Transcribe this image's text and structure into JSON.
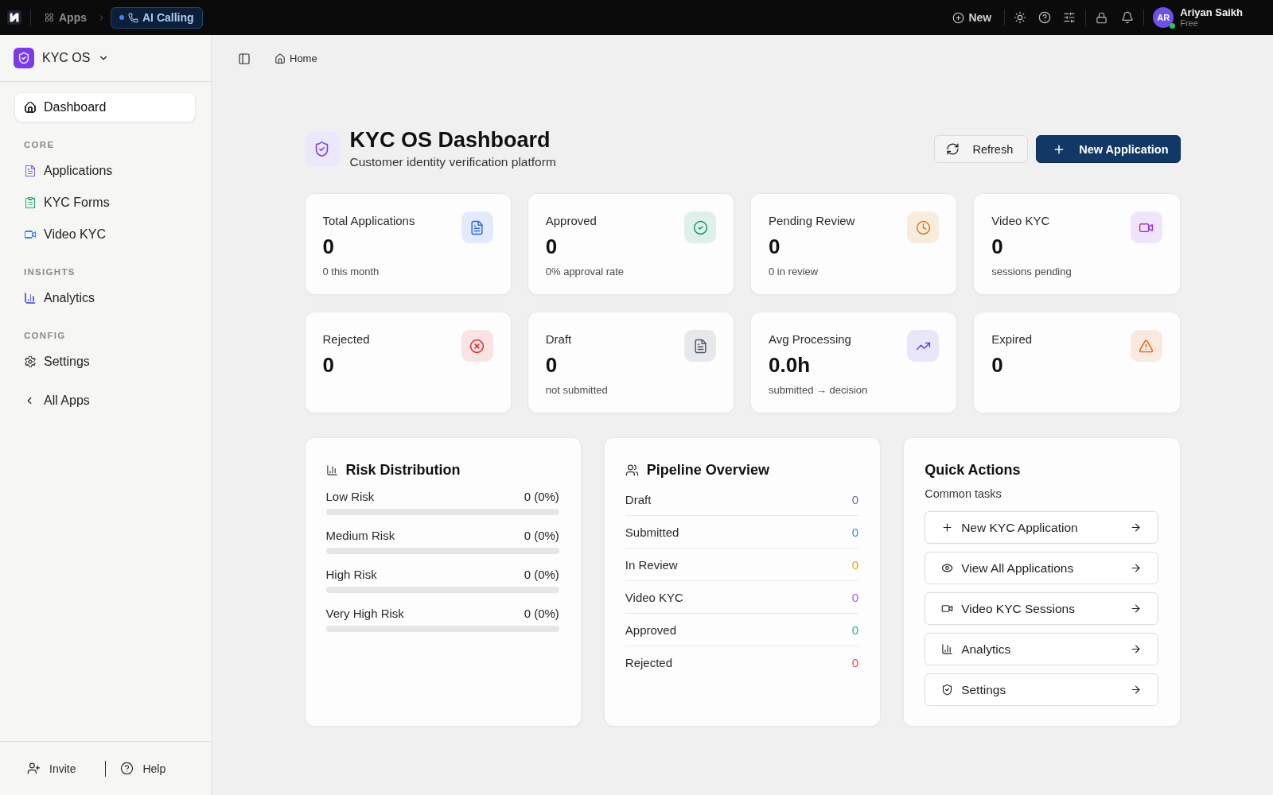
{
  "top_bar": {
    "apps_label": "Apps",
    "current_app": "AI Calling",
    "new_label": "New",
    "user": {
      "initials": "AR",
      "name": "Ariyan Saikh",
      "plan": "Free",
      "online": true
    }
  },
  "sidebar": {
    "workspace": "KYC OS",
    "items": [
      {
        "label": "Dashboard",
        "selected": true,
        "color": "#2b2b2b"
      }
    ],
    "sections": [
      {
        "title": "CORE",
        "items": [
          {
            "label": "Applications",
            "selected": false,
            "color": "#8b5cf6"
          },
          {
            "label": "KYC Forms",
            "selected": false,
            "color": "#22a861"
          },
          {
            "label": "Video KYC",
            "selected": false,
            "color": "#3b82f6"
          }
        ]
      },
      {
        "title": "INSIGHTS",
        "items": [
          {
            "label": "Analytics",
            "selected": false,
            "color": "#6366f1"
          }
        ]
      },
      {
        "title": "CONFIG",
        "items": [
          {
            "label": "Settings",
            "selected": false,
            "color": "#555555"
          }
        ]
      }
    ],
    "back_label": "All Apps",
    "footer": [
      "Invite",
      "Help"
    ]
  },
  "breadcrumb": "Home",
  "header": {
    "title": "KYC OS Dashboard",
    "subtitle": "Customer identity verification platform",
    "buttons": [
      {
        "label": "Refresh",
        "kind": "secondary"
      },
      {
        "label": "New Application",
        "kind": "primary"
      }
    ]
  },
  "stats": [
    {
      "label": "Total Applications",
      "value": "0",
      "note": "0 this month",
      "color": "#2563eb"
    },
    {
      "label": "Approved",
      "value": "0",
      "note": "0% approval rate",
      "color": "#059669"
    },
    {
      "label": "Pending Review",
      "value": "0",
      "note": "0 in review",
      "color": "#d97706"
    },
    {
      "label": "Video KYC",
      "value": "0",
      "note": "sessions pending",
      "color": "#9333ea"
    },
    {
      "label": "Rejected",
      "value": "0",
      "color": "#dc2626"
    },
    {
      "label": "Draft",
      "value": "0",
      "note": "not submitted",
      "color": "#475569"
    },
    {
      "label": "Avg Processing",
      "value": "0.0h",
      "note": "submitted → decision",
      "color": "#4f46e5"
    },
    {
      "label": "Expired",
      "value": "0",
      "color": "#ea580c"
    }
  ],
  "risk_distribution": {
    "title": "Risk Distribution",
    "rows": [
      {
        "label": "Low Risk",
        "reading": "0 (0%)",
        "level": 0
      },
      {
        "label": "Medium Risk",
        "reading": "0 (0%)",
        "level": 0
      },
      {
        "label": "High Risk",
        "reading": "0 (0%)",
        "level": 0
      },
      {
        "label": "Very High Risk",
        "reading": "0 (0%)",
        "level": 0
      }
    ]
  },
  "pipeline": {
    "title": "Pipeline Overview",
    "rows": [
      {
        "label": "Draft",
        "value": "0",
        "color": "#64748b"
      },
      {
        "label": "Submitted",
        "value": "0",
        "color": "#3b82f6"
      },
      {
        "label": "In Review",
        "value": "0",
        "color": "#f59e0b"
      },
      {
        "label": "Video KYC",
        "value": "0",
        "color": "#a855f7"
      },
      {
        "label": "Approved",
        "value": "0",
        "color": "#10b981"
      },
      {
        "label": "Rejected",
        "value": "0",
        "color": "#ef4444"
      }
    ]
  },
  "quick_actions": {
    "title": "Quick Actions",
    "subtitle": "Common tasks",
    "actions": [
      "New KYC Application",
      "View All Applications",
      "Video KYC Sessions",
      "Analytics",
      "Settings"
    ]
  }
}
